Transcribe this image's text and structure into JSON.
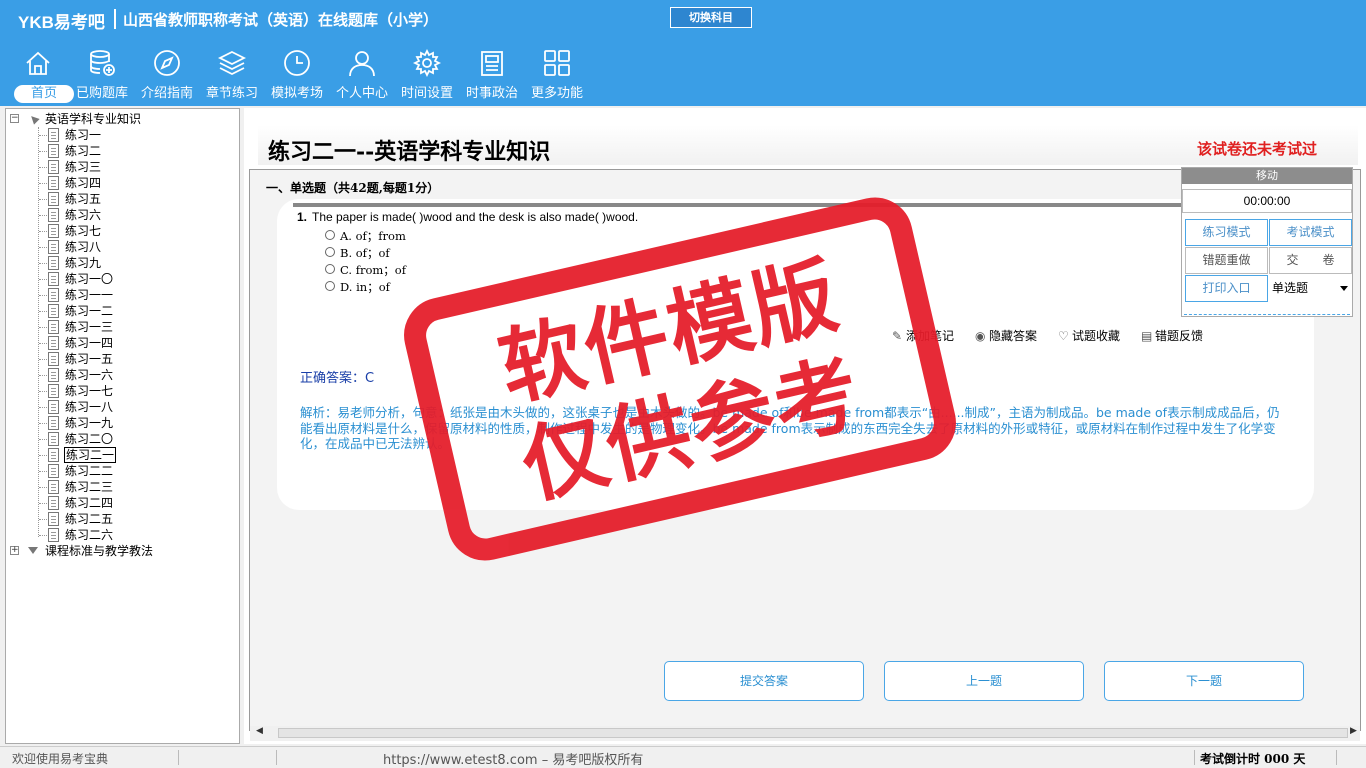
{
  "header": {
    "logo": "YKB易考吧",
    "app_title": "山西省教师职称考试（英语）在线题库（小学）",
    "switch_subject": "切换科目"
  },
  "nav": [
    {
      "label": "首页",
      "icon": "home-icon"
    },
    {
      "label": "已购题库",
      "icon": "database-icon"
    },
    {
      "label": "介绍指南",
      "icon": "compass-icon"
    },
    {
      "label": "章节练习",
      "icon": "layers-icon"
    },
    {
      "label": "模拟考场",
      "icon": "clock-icon"
    },
    {
      "label": "个人中心",
      "icon": "user-icon"
    },
    {
      "label": "时间设置",
      "icon": "gear-icon"
    },
    {
      "label": "时事政治",
      "icon": "news-icon"
    },
    {
      "label": "更多功能",
      "icon": "grid-icon"
    }
  ],
  "tree": {
    "root": "英语学科专业知识",
    "items": [
      "练习一",
      "练习二",
      "练习三",
      "练习四",
      "练习五",
      "练习六",
      "练习七",
      "练习八",
      "练习九",
      "练习一〇",
      "练习一一",
      "练习一二",
      "练习一三",
      "练习一四",
      "练习一五",
      "练习一六",
      "练习一七",
      "练习一八",
      "练习一九",
      "练习二〇",
      "练习二一",
      "练习二二",
      "练习二三",
      "练习二四",
      "练习二五",
      "练习二六"
    ],
    "selected": "练习二一",
    "collapsed": "课程标准与教学教法"
  },
  "paper": {
    "title": "练习二一--英语学科专业知识",
    "status": "该试卷还未考试过",
    "section": "一、单选题（共42题,每题1分）"
  },
  "question": {
    "number": "1.",
    "text": "The paper is made(  )wood and the desk is also made(  )wood.",
    "options": [
      "A. of；from",
      "B. of；of",
      "C. from；of",
      "D. in；of"
    ]
  },
  "tools": {
    "add_note": "添加笔记",
    "hide_answer": "隐藏答案",
    "favorite": "试题收藏",
    "report": "错题反馈"
  },
  "answer": "正确答案：C",
  "analysis": "解析：易老师分析，句意：纸张是由木头做的，这张桌子也是由木头做的。be made of和be made from都表示“由......制成”，主语为制成品。be made of表示制成成品后，仍能看出原材料是什么，保留原材料的性质，制作过程中发生的是物理变化。be made from表示制成的东西完全失去了原材料的外形或特征，或原材料在制作过程中发生了化学变化，在成品中已无法辨认。",
  "actions": {
    "submit": "提交答案",
    "prev": "上一题",
    "next": "下一题"
  },
  "panel": {
    "move": "移动",
    "timer": "00:00:00",
    "practice_mode": "练习模式",
    "exam_mode": "考试模式",
    "redo_wrong": "错题重做",
    "hand_in": "交　　卷",
    "print": "打印入口",
    "type_select": "单选题"
  },
  "watermark": {
    "line1": "软件模版",
    "line2": "仅供参考"
  },
  "status": {
    "welcome": "欢迎使用易考宝典",
    "copyright": "https://www.etest8.com – 易考吧版权所有",
    "countdown": "考试倒计时 000 天"
  },
  "colors": {
    "header_bg": "#3a9ee6",
    "stamp_red": "#e51d2a",
    "status_red": "#e02020",
    "answer_blue": "#1a3fa8",
    "analysis_blue": "#2a8fd1"
  }
}
